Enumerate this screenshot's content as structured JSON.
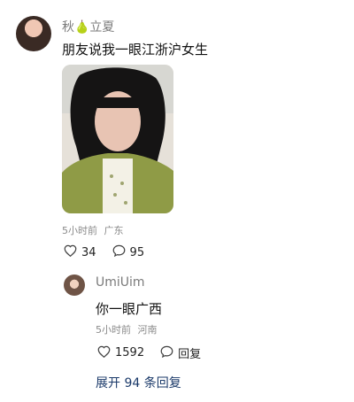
{
  "post": {
    "user_name": "秋🍐立夏",
    "text": "朋友说我一眼江浙沪女生",
    "time": "5小时前",
    "location": "广东",
    "likes": "34",
    "comments": "95"
  },
  "reply": {
    "user_name": "UmiUim",
    "text": "你一眼广西",
    "time": "5小时前",
    "location": "河南",
    "likes": "1592",
    "reply_label": "回复"
  },
  "expand_label": "展开 94 条回复",
  "icons": {
    "heart": "heart-icon",
    "comment": "comment-icon"
  }
}
